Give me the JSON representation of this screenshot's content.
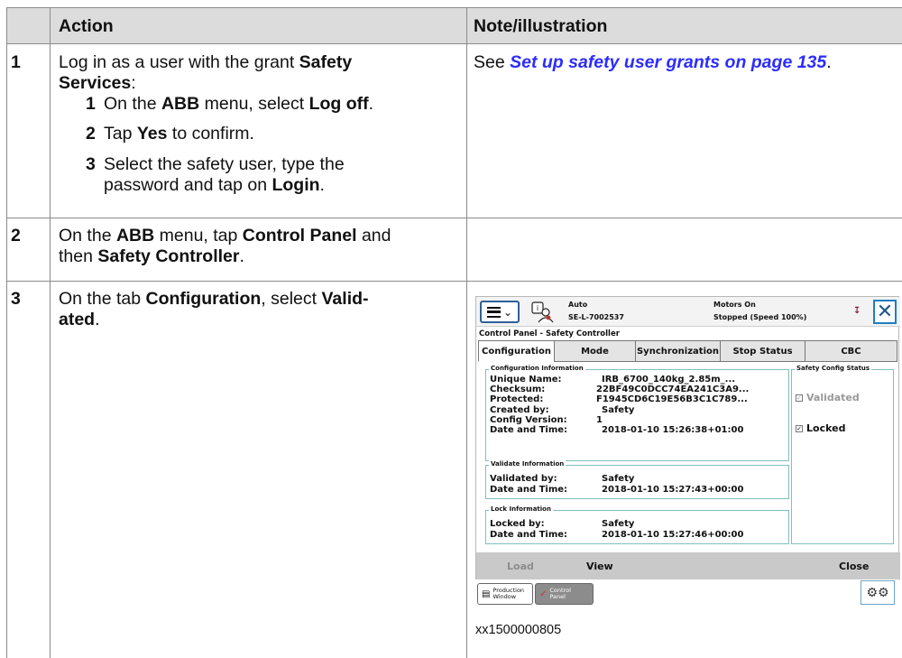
{
  "table": {
    "headers": {
      "number": "",
      "action": "Action",
      "note": "Note/illustration"
    },
    "rows": [
      {
        "number": "1",
        "action_parts": [
          "Log in as a user with the grant ",
          "Safety",
          "Services",
          ":"
        ],
        "substeps": [
          {
            "n": "1",
            "parts": [
              "On the ",
              "ABB",
              " menu, select ",
              "Log off",
              "."
            ]
          },
          {
            "n": "2",
            "parts": [
              "Tap ",
              "Yes",
              " to confirm."
            ]
          },
          {
            "n": "3",
            "parts": [
              "Select the safety user, type the",
              "password and tap on ",
              "Login",
              "."
            ]
          }
        ],
        "note_prefix": "See ",
        "note_link": "Set up safety user grants on page 135",
        "note_suffix": "."
      },
      {
        "number": "2",
        "action_parts": [
          "On the ",
          "ABB",
          " menu, tap ",
          "Control Panel",
          " and",
          "then ",
          "Safety Controller",
          "."
        ]
      },
      {
        "number": "3",
        "action_parts": [
          "On the tab ",
          "Configuration",
          ", select ",
          "Valid-",
          "ated",
          "."
        ],
        "caption": "xx1500000805"
      }
    ]
  },
  "flexpendant": {
    "status": {
      "mode": "Auto",
      "controller": "SE-L-7002537",
      "motors": "Motors On",
      "state": "Stopped (Speed 100%)"
    },
    "panel_title": "Control Panel - Safety Controller",
    "tabs": [
      {
        "label": "Configuration",
        "active": true
      },
      {
        "label": "Mode",
        "active": false
      },
      {
        "label": "Synchronization",
        "active": false
      },
      {
        "label": "Stop Status",
        "active": false
      },
      {
        "label": "CBC",
        "active": false
      }
    ],
    "config_info": {
      "title": "Configuration Information",
      "rows": [
        {
          "label": "Unique Name:",
          "value": "IRB_6700_140kg_2.85m_..."
        },
        {
          "label": "Checksum:",
          "value": "22BF49C0DCC74EA241C3A9..."
        },
        {
          "label": "Protected:",
          "value": "F1945CD6C19E56B3C1C789..."
        },
        {
          "label": "Created by:",
          "value": "Safety"
        },
        {
          "label": "Config Version:",
          "value": "1"
        },
        {
          "label": "Date and Time:",
          "value": "2018-01-10 15:26:38+01:00"
        }
      ]
    },
    "validate_info": {
      "title": "Validate Information",
      "rows": [
        {
          "label": "Validated by:",
          "value": "Safety"
        },
        {
          "label": "Date and Time:",
          "value": "2018-01-10 15:27:43+00:00"
        }
      ]
    },
    "lock_info": {
      "title": "Lock Information",
      "rows": [
        {
          "label": "Locked by:",
          "value": "Safety"
        },
        {
          "label": "Date and Time:",
          "value": "2018-01-10 15:27:46+00:00"
        }
      ]
    },
    "status_box": {
      "title": "Safety Config Status",
      "validated": {
        "label": "Validated",
        "checked": true,
        "enabled": false
      },
      "locked": {
        "label": "Locked",
        "checked": true,
        "enabled": true
      }
    },
    "buttons": {
      "load": "Load",
      "view": "View",
      "close": "Close"
    },
    "taskbar": {
      "production": [
        "Production",
        "Window"
      ],
      "control": [
        "Control",
        "Panel"
      ]
    }
  }
}
